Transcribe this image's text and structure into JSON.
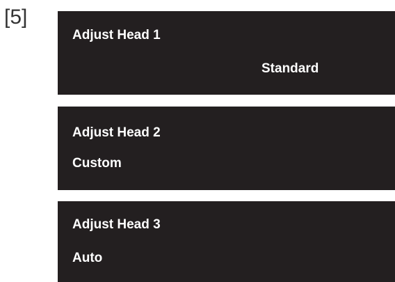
{
  "step": {
    "label": "[5]"
  },
  "menu": {
    "items": [
      {
        "title": "Adjust Head 1",
        "value": "Standard"
      },
      {
        "title": "Adjust Head 2",
        "value": "Custom"
      },
      {
        "title": "Adjust Head 3",
        "value": "Auto"
      }
    ]
  },
  "colors": {
    "panel_background": "#231f20",
    "panel_text": "#ffffff",
    "step_label": "#333333",
    "page_background": "#ffffff"
  }
}
